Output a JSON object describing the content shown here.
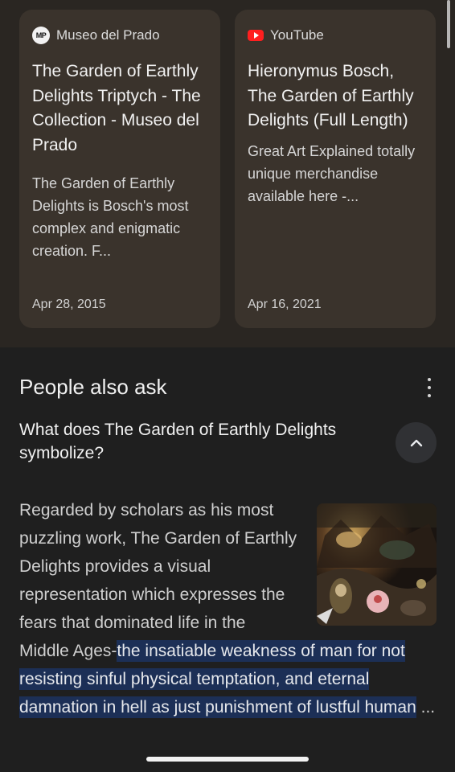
{
  "cards": [
    {
      "source": "Museo del Prado",
      "icon": "museo-del-prado-logo-icon",
      "icon_text": "MP",
      "title": "The Garden of Earthly Delights Triptych - The Collection - Museo del Prado",
      "snippet": "The Garden of Earthly Delights is Bosch's most complex and enigmatic creation. F...",
      "date": "Apr 28, 2015"
    },
    {
      "source": "YouTube",
      "icon": "youtube-logo-icon",
      "title": "Hieronymus Bosch, The Garden of Earthly Delights (Full Length)",
      "snippet": "Great Art Explained totally unique merchandise available here -...",
      "date": "Apr 16, 2021"
    }
  ],
  "people_also_ask": {
    "header": "People also ask",
    "menu_icon": "more-vert-icon",
    "question": "What does The Garden of Earthly Delights symbolize?",
    "toggle_icon": "chevron-up-icon",
    "answer_lead": "Regarded by scholars as his most puzzling work, The Garden of Earthly Delights provides a visual representation which expresses the fears that dominated life in the",
    "answer_plain": "Middle Ages-",
    "answer_highlight": "the insatiable weakness of man for not resisting sinful physical temptation, and eternal damnation in hell as just punishment of lustful human",
    "answer_ellipsis": " ..."
  },
  "colors": {
    "background": "#1f1f1f",
    "card_background": "#3a332c",
    "highlight": "#1c2f56",
    "youtube_red": "#ff1f1f"
  }
}
